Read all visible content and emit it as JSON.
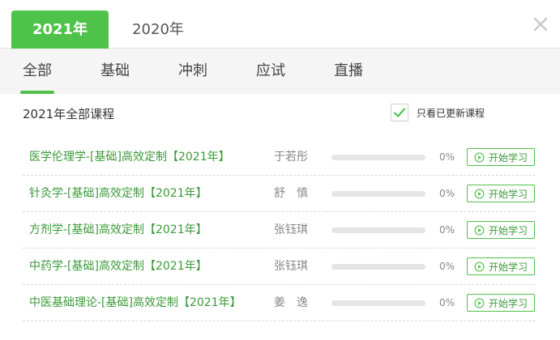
{
  "year_tabs": [
    {
      "label": "2021年",
      "active": true
    },
    {
      "label": "2020年",
      "active": false
    }
  ],
  "category_tabs": [
    {
      "label": "全部",
      "active": true
    },
    {
      "label": "基础",
      "active": false
    },
    {
      "label": "冲刺",
      "active": false
    },
    {
      "label": "应试",
      "active": false
    },
    {
      "label": "直播",
      "active": false
    }
  ],
  "section_title": "2021年全部课程",
  "filter": {
    "label": "只看已更新课程",
    "checked": true
  },
  "courses": [
    {
      "name": "医学伦理学-[基础]高效定制【2021年】",
      "teacher": "于若彤",
      "progress_percent": 0,
      "progress_text": "0%",
      "action": "开始学习"
    },
    {
      "name": "针灸学-[基础]高效定制【2021年】",
      "teacher": "舒　慎",
      "progress_percent": 0,
      "progress_text": "0%",
      "action": "开始学习"
    },
    {
      "name": "方剂学-[基础]高效定制【2021年】",
      "teacher": "张钰琪",
      "progress_percent": 0,
      "progress_text": "0%",
      "action": "开始学习"
    },
    {
      "name": "中药学-[基础]高效定制【2021年】",
      "teacher": "张钰琪",
      "progress_percent": 0,
      "progress_text": "0%",
      "action": "开始学习"
    },
    {
      "name": "中医基础理论-[基础]高效定制【2021年】",
      "teacher": "姜　逸",
      "progress_percent": 0,
      "progress_text": "0%",
      "action": "开始学习"
    }
  ],
  "colors": {
    "accent": "#4fc24a",
    "link": "#3c9a3a"
  },
  "icons": {
    "close": "close-icon",
    "check": "check-icon",
    "play": "play-circle-icon"
  }
}
